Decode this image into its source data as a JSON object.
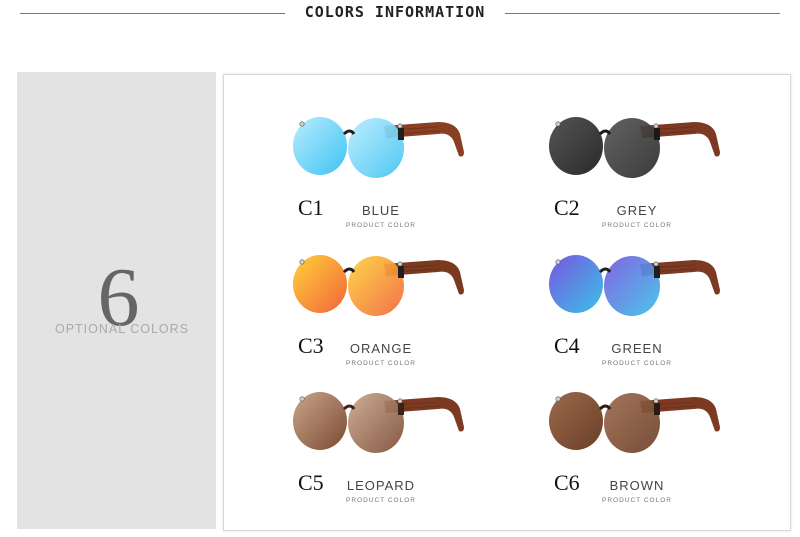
{
  "header": {
    "title": "COLORS INFORMATION"
  },
  "left": {
    "count": "6",
    "label": "OPTIONAL COLORS"
  },
  "items": [
    {
      "code": "C1",
      "name": "BLUE",
      "sub": "PRODUCT COLOR",
      "lens": "#3ec3f2",
      "lens_light": "#b9ecff",
      "frame": "#1f1f1f",
      "arm": "#8a3f22"
    },
    {
      "code": "C2",
      "name": "GREY",
      "sub": "PRODUCT COLOR",
      "lens": "#2a2a2a",
      "lens_light": "#555555",
      "frame": "#1a1a1a",
      "arm": "#7d3a22"
    },
    {
      "code": "C3",
      "name": "ORANGE",
      "sub": "PRODUCT COLOR",
      "lens": "#f2643a",
      "lens_light": "#ffd23a",
      "frame": "#1f1f1f",
      "arm": "#7a3a20"
    },
    {
      "code": "C4",
      "name": "GREEN",
      "sub": "PRODUCT COLOR",
      "lens": "#38c3e6",
      "lens_light": "#7a55e0",
      "frame": "#1f1f1f",
      "arm": "#7d3a22"
    },
    {
      "code": "C5",
      "name": "LEOPARD",
      "sub": "PRODUCT COLOR",
      "lens": "#7a4a33",
      "lens_light": "#caa68a",
      "frame": "#3a2418",
      "arm": "#7d3a22"
    },
    {
      "code": "C6",
      "name": "BROWN",
      "sub": "PRODUCT COLOR",
      "lens": "#6a3e28",
      "lens_light": "#9c6a4c",
      "frame": "#2a1a12",
      "arm": "#7d3a22"
    }
  ]
}
